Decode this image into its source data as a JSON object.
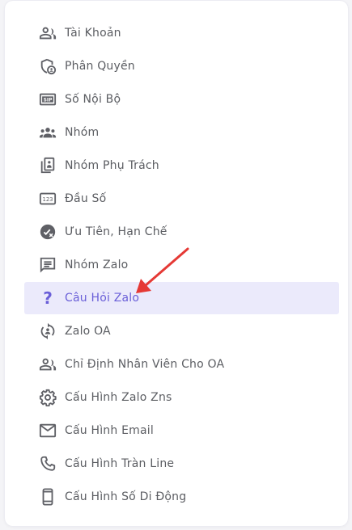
{
  "menu": {
    "items": [
      {
        "label": "Tài Khoản",
        "icon": "people-icon"
      },
      {
        "label": "Phân Quyền",
        "icon": "shield-user-icon"
      },
      {
        "label": "Số Nội Bộ",
        "icon": "sip-icon"
      },
      {
        "label": "Nhóm",
        "icon": "group-icon"
      },
      {
        "label": "Nhóm Phụ Trách",
        "icon": "assigned-group-icon"
      },
      {
        "label": "Đầu Số",
        "icon": "number-123-icon"
      },
      {
        "label": "Ưu Tiên, Hạn Chế",
        "icon": "priority-restrict-icon"
      },
      {
        "label": "Nhóm Zalo",
        "icon": "chat-icon"
      },
      {
        "label": "Câu Hỏi Zalo",
        "icon": "question-mark-icon",
        "active": true
      },
      {
        "label": "Zalo OA",
        "icon": "sync-person-icon"
      },
      {
        "label": "Chỉ Định Nhân Viên Cho OA",
        "icon": "people-icon"
      },
      {
        "label": "Cấu Hình Zalo Zns",
        "icon": "gear-icon"
      },
      {
        "label": "Cấu Hình Email",
        "icon": "mail-icon"
      },
      {
        "label": "Cấu Hình Tràn Line",
        "icon": "phone-icon"
      },
      {
        "label": "Cấu Hình Số Di Động",
        "icon": "mobile-icon"
      }
    ]
  },
  "colors": {
    "active_bg": "#ebeafb",
    "active_text": "#6a5fd8",
    "text": "#5b5d62",
    "icon": "#5f6066",
    "annotation_arrow": "#e53935"
  }
}
